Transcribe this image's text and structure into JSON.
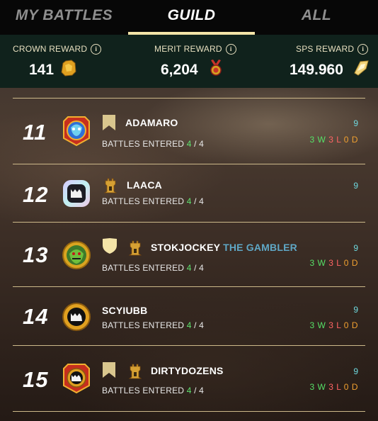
{
  "tabs": [
    {
      "label": "MY BATTLES",
      "active": false
    },
    {
      "label": "GUILD",
      "active": true
    },
    {
      "label": "ALL",
      "active": false
    }
  ],
  "rewards": [
    {
      "label": "CROWN REWARD",
      "value": "141",
      "icon": "crown-token-icon"
    },
    {
      "label": "MERIT REWARD",
      "value": "6,204",
      "icon": "merit-medal-icon"
    },
    {
      "label": "SPS REWARD",
      "value": "149.960",
      "icon": "sps-crystal-icon"
    }
  ],
  "players": [
    {
      "rank": "11",
      "name": "ADAMARO",
      "title": "",
      "battles_label": "BATTLES ENTERED",
      "entered": "4",
      "total": "4",
      "score": "9",
      "wins": "3",
      "w": "W",
      "losses": "3",
      "l": "L",
      "draws": "0",
      "d": "D",
      "badges": [
        "banner-badge-icon"
      ]
    },
    {
      "rank": "12",
      "name": "LAACA",
      "title": "",
      "battles_label": "BATTLES ENTERED",
      "entered": "4",
      "total": "4",
      "score": "9",
      "wins": "",
      "w": "",
      "losses": "",
      "l": "",
      "draws": "",
      "d": "",
      "badges": [
        "tower-badge-icon"
      ]
    },
    {
      "rank": "13",
      "name": "STOKJOCKEY",
      "title": "THE GAMBLER",
      "battles_label": "BATTLES ENTERED",
      "entered": "4",
      "total": "4",
      "score": "9",
      "wins": "3",
      "w": "W",
      "losses": "3",
      "l": "L",
      "draws": "0",
      "d": "D",
      "badges": [
        "shield-badge-icon",
        "tower-badge-icon"
      ]
    },
    {
      "rank": "14",
      "name": "SCYIUBB",
      "title": "",
      "battles_label": "BATTLES ENTERED",
      "entered": "4",
      "total": "4",
      "score": "9",
      "wins": "3",
      "w": "W",
      "losses": "3",
      "l": "L",
      "draws": "0",
      "d": "D",
      "badges": []
    },
    {
      "rank": "15",
      "name": "DIRTYDOZENS",
      "title": "",
      "battles_label": "BATTLES ENTERED",
      "entered": "4",
      "total": "4",
      "score": "9",
      "wins": "3",
      "w": "W",
      "losses": "3",
      "l": "L",
      "draws": "0",
      "d": "D",
      "badges": [
        "banner-badge-icon",
        "tower-badge-icon"
      ]
    }
  ],
  "colors": {
    "tab_active_underline": "#f4e4a8",
    "rewards_bg": "#10221c",
    "wins": "#56e067",
    "losses": "#ff6464",
    "draws": "#f0a030",
    "score": "#6ed9df",
    "entered": "#5ee26f",
    "title_suffix": "#5fa7c5"
  }
}
